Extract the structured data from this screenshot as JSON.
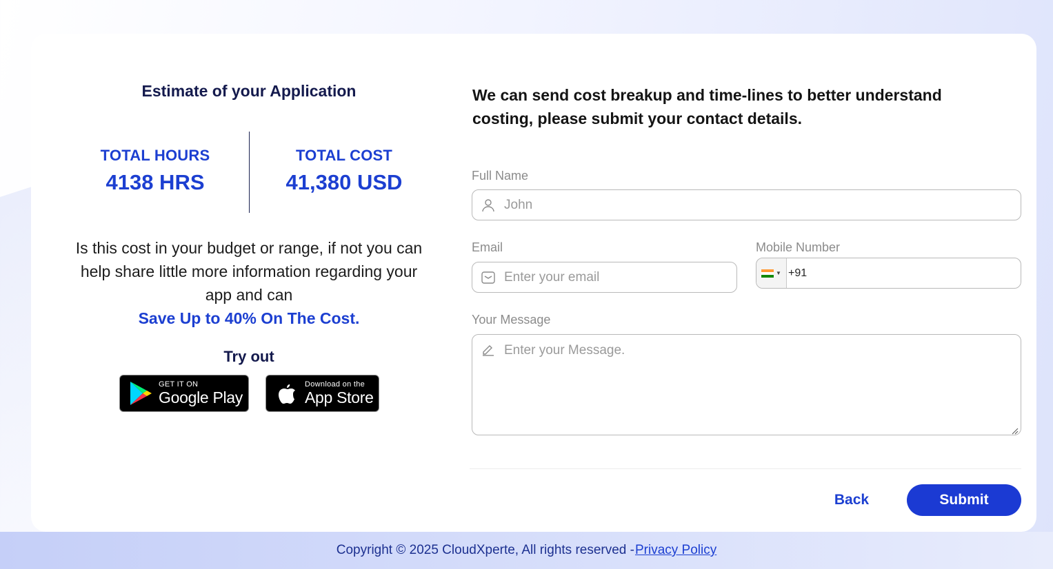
{
  "estimate": {
    "title": "Estimate of your Application",
    "hours_label": "TOTAL HOURS",
    "hours_value": "4138 HRS",
    "cost_label": "TOTAL COST",
    "cost_value": "41,380 USD",
    "pitch_text": "Is this cost in your budget or range, if not you can help share little more information regarding your app and can",
    "pitch_highlight": "Save Up to 40% On The Cost.",
    "try_out": "Try out",
    "google_play": {
      "small": "GET IT ON",
      "big": "Google Play",
      "icon": "google-play-icon"
    },
    "app_store": {
      "small": "Download on the",
      "big": "App Store",
      "icon": "apple-icon"
    }
  },
  "form": {
    "heading": "We can send cost breakup and time-lines to better understand costing, please submit your contact details.",
    "full_name": {
      "label": "Full Name",
      "placeholder": "John",
      "icon": "user-icon"
    },
    "email": {
      "label": "Email",
      "placeholder": "Enter your email",
      "icon": "mail-icon"
    },
    "mobile": {
      "label": "Mobile Number",
      "value": "+91",
      "country": "India",
      "icon": "india-flag-icon"
    },
    "message": {
      "label": "Your Message",
      "placeholder": "Enter your Message.",
      "icon": "pencil-icon"
    },
    "back_label": "Back",
    "submit_label": "Submit"
  },
  "footer": {
    "copyright": "Copyright © 2025 CloudXperte, All rights reserved -",
    "privacy_link": "Privacy Policy"
  },
  "colors": {
    "accent": "#1c3fd1",
    "submit_bg": "#1b3ad3",
    "heading_dark": "#141a4d"
  }
}
